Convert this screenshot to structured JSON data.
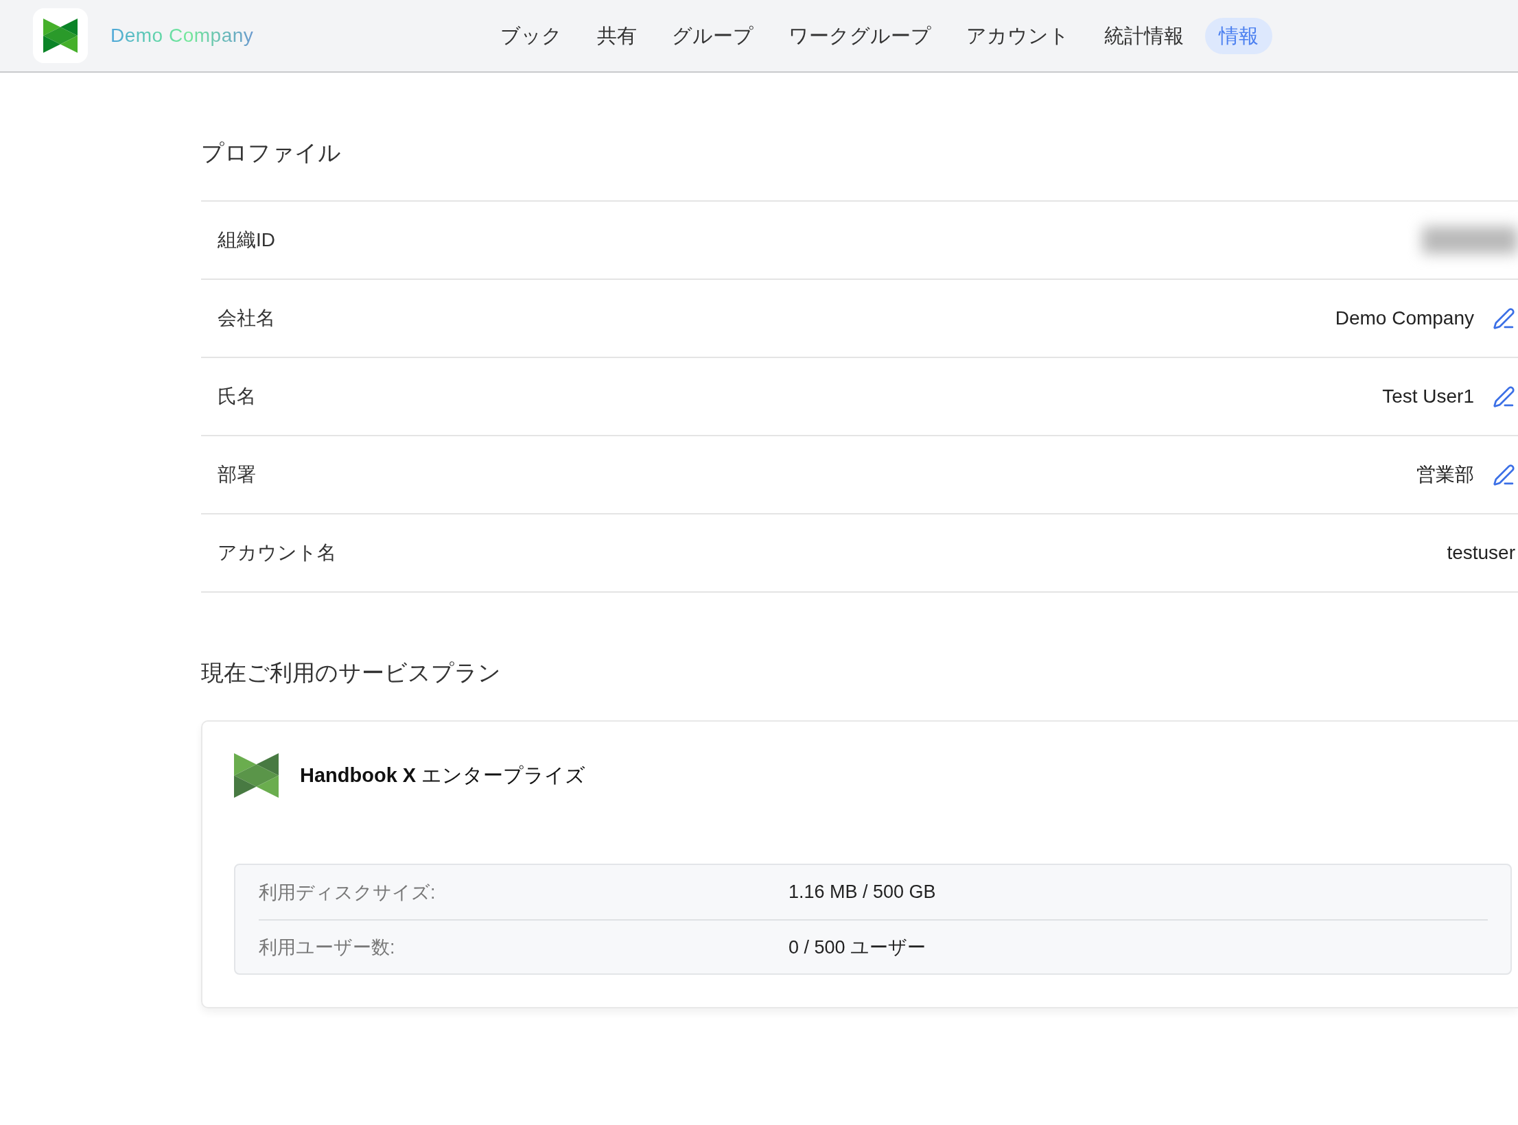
{
  "header": {
    "company_name": "Demo Company",
    "nav": [
      {
        "label": "ブック",
        "selected": false
      },
      {
        "label": "共有",
        "selected": false
      },
      {
        "label": "グループ",
        "selected": false
      },
      {
        "label": "ワークグループ",
        "selected": false
      },
      {
        "label": "アカウント",
        "selected": false
      },
      {
        "label": "統計情報",
        "selected": false
      },
      {
        "label": "情報",
        "selected": true
      }
    ]
  },
  "profile": {
    "title": "プロファイル",
    "rows": [
      {
        "label": "組織ID",
        "kind": "redacted",
        "editable": false
      },
      {
        "label": "会社名",
        "kind": "text",
        "value": "Demo Company",
        "editable": true
      },
      {
        "label": "氏名",
        "kind": "text",
        "value": "Test User1",
        "editable": true
      },
      {
        "label": "部署",
        "kind": "text",
        "value": "営業部",
        "editable": true
      },
      {
        "label": "アカウント名",
        "kind": "text",
        "value": "testuser",
        "editable": false
      }
    ]
  },
  "plan": {
    "title": "現在ご利用のサービスプラン",
    "name": "**Handbook X** エンタープライズ",
    "stats": [
      {
        "label": "利用ディスクサイズ:",
        "value": "1.16 MB / 500 GB"
      },
      {
        "label": "利用ユーザー数:",
        "value": "0 / 500 ユーザー"
      }
    ]
  }
}
